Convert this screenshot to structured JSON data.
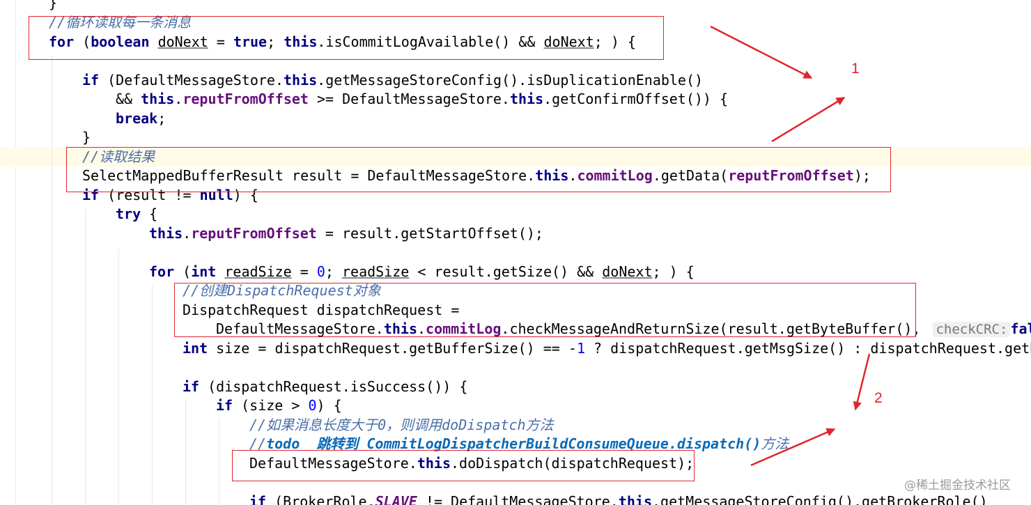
{
  "code": {
    "l0": {
      "brace": "}"
    },
    "l1": {
      "comment": "//循环读取每一条消息"
    },
    "l2": {
      "k_for": "for",
      "t1": " (",
      "k_boolean": "boolean",
      "t2": " ",
      "v_doNext": "doNext",
      "t3": " = ",
      "k_true": "true",
      "t4": "; ",
      "k_this": "this",
      "t5": ".isCommitLogAvailable() && ",
      "v_doNext2": "doNext",
      "t6": "; ) {"
    },
    "l3": {
      "k_if": "if",
      "t1": " (DefaultMessageStore.",
      "k_this": "this",
      "t2": ".getMessageStoreConfig().isDuplicationEnable()"
    },
    "l4": {
      "t0": "&& ",
      "k_this": "this",
      "t1": ".",
      "f_reput": "reputFromOffset",
      "t2": " >= DefaultMessageStore.",
      "k_this2": "this",
      "t3": ".getConfirmOffset()) {"
    },
    "l5": {
      "k_break": "break",
      "t1": ";"
    },
    "l6": {
      "brace": "}"
    },
    "l7": {
      "comment": "//读取结果"
    },
    "l8": {
      "t0": "SelectMappedBufferResult result = DefaultMessageStore.",
      "k_this": "this",
      "t1": ".",
      "f_commitLog": "commitLog",
      "t2": ".getData(",
      "f_reput": "reputFromOffset",
      "t3": ");"
    },
    "l9": {
      "k_if": "if",
      "t1": " (result != ",
      "k_null": "null",
      "t2": ") {"
    },
    "l10": {
      "k_try": "try",
      "t1": " {"
    },
    "l11": {
      "k_this": "this",
      "t1": ".",
      "f_reput": "reputFromOffset",
      "t2": " = result.getStartOffset();"
    },
    "l12": {
      "k_for": "for",
      "t1": " (",
      "k_int": "int",
      "t2": " ",
      "v_readSize": "readSize",
      "t3": " = ",
      "n0": "0",
      "t4": "; ",
      "v_readSize2": "readSize",
      "t5": " < result.getSize() && ",
      "v_doNext": "doNext",
      "t6": "; ) {"
    },
    "l13": {
      "comment": "//创建DispatchRequest对象"
    },
    "l14": {
      "t0": "DispatchRequest dispatchRequest ="
    },
    "l15": {
      "t0": "DefaultMessageStore.",
      "k_this": "this",
      "t1": ".",
      "f_commitLog": "commitLog",
      "t2": ".checkMessageAndReturnSize(result.getByteBuffer(),",
      "hint": "checkCRC:",
      "k_false": "fal"
    },
    "l16": {
      "k_int": "int",
      "t1": " size = dispatchRequest.getBufferSize() == -",
      "n1": "1",
      "t2": " ? dispatchRequest.getMsgSize() : dispatchRequest.getB"
    },
    "l17": {
      "k_if": "if",
      "t1": " (dispatchRequest.isSuccess()) {"
    },
    "l18": {
      "k_if": "if",
      "t1": " (size > ",
      "n0": "0",
      "t2": ") {"
    },
    "l19": {
      "comment": "//如果消息长度大于0，则调用doDispatch方法"
    },
    "l20": {
      "c_slash": "//",
      "todo": "todo  跳转到 CommitLogDispatcherBuildConsumeQueue.dispatch()",
      "c_tail": "方法"
    },
    "l21": {
      "t0": "DefaultMessageStore.",
      "k_this": "this",
      "t1": ".doDispatch(dispatchRequest);"
    },
    "l22": {
      "k_if": "if",
      "t1": " (BrokerRole.",
      "f_slave": "SLAVE",
      "t2": " != DefaultMessageStore.",
      "k_this": "this",
      "t3": ".getMessageStoreConfig().getBrokerRole()"
    }
  },
  "annotations": {
    "label1": "1",
    "label2": "2"
  },
  "watermark": "@稀土掘金技术社区",
  "colors": {
    "keyword": "#000080",
    "field": "#660e7a",
    "comment": "#4a6fa8",
    "todo": "#0a6ab8",
    "number": "#0000ff",
    "annotation": "#e0242b"
  }
}
